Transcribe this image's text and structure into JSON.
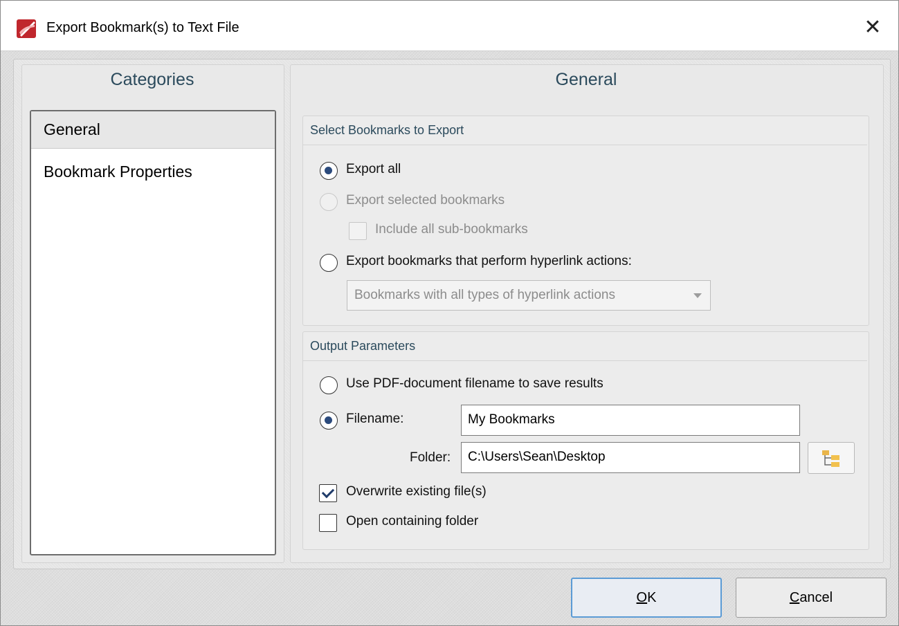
{
  "window": {
    "title": "Export Bookmark(s) to Text File",
    "close_glyph": "✕"
  },
  "categories": {
    "header": "Categories",
    "items": [
      {
        "label": "General",
        "selected": true
      },
      {
        "label": "Bookmark Properties",
        "selected": false
      }
    ]
  },
  "general": {
    "header": "General",
    "select_group": {
      "title": "Select Bookmarks to Export",
      "export_all": "Export all",
      "export_selected": "Export selected bookmarks",
      "include_sub": "Include all sub-bookmarks",
      "export_hyperlink": "Export bookmarks that perform hyperlink actions:",
      "hyperlink_type_value": "Bookmarks with all types of hyperlink actions"
    },
    "output_group": {
      "title": "Output Parameters",
      "use_pdf_name": "Use PDF-document filename to save results",
      "filename_label": "Filename:",
      "filename_value": "My Bookmarks",
      "folder_label": "Folder:",
      "folder_value": "C:\\Users\\Sean\\Desktop",
      "overwrite": "Overwrite existing file(s)",
      "open_folder": "Open containing folder"
    }
  },
  "buttons": {
    "ok_first": "O",
    "ok_rest": "K",
    "cancel_first": "C",
    "cancel_rest": "ancel"
  },
  "icons": {
    "app": "pdf-xchange-logo-icon",
    "browse": "folder-tree-icon"
  },
  "colors": {
    "accent": "#5b9bd5",
    "header_text": "#2b4a5c"
  }
}
